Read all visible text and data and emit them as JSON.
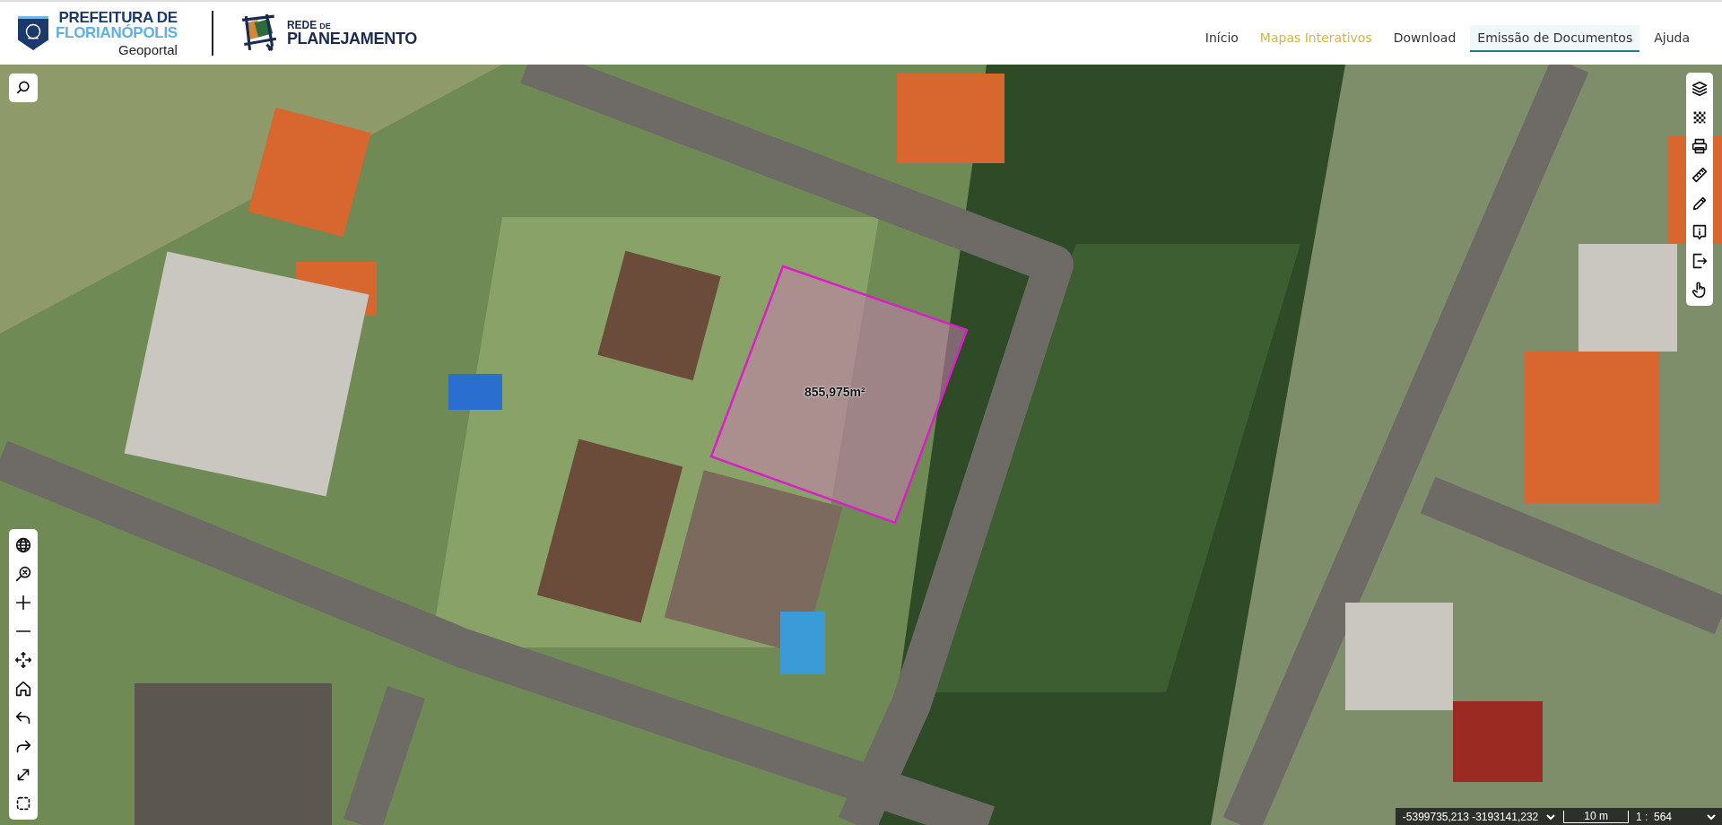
{
  "header": {
    "logo1": {
      "line1": "PREFEITURA DE",
      "line2": "FLORIANÓPOLIS",
      "subtitle": "Geoportal"
    },
    "logo2": {
      "line1": "REDE",
      "line1_small": "DE",
      "line2": "PLANEJAMENTO"
    },
    "nav": [
      {
        "label": "Início",
        "selected": false,
        "highlighted": false
      },
      {
        "label": "Mapas Interativos",
        "selected": false,
        "highlighted": true
      },
      {
        "label": "Download",
        "selected": false,
        "highlighted": false
      },
      {
        "label": "Emissão de Documentos",
        "selected": true,
        "highlighted": false
      },
      {
        "label": "Ajuda",
        "selected": false,
        "highlighted": false
      }
    ]
  },
  "map": {
    "parcel": {
      "area": "855,975m²"
    },
    "status_bar": {
      "coordinates": "-5399735,213 -3193141,232",
      "scale": "10 m",
      "ratio": "1 :  564"
    }
  }
}
